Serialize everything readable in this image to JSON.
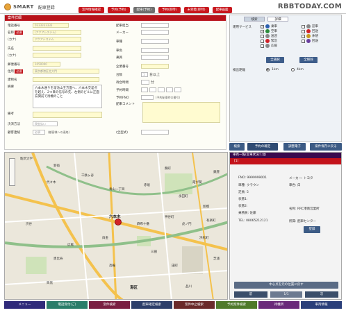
{
  "app": {
    "logo": "SMART",
    "subtitle": "配車登録"
  },
  "watermark": "RBBTODAY.COM",
  "top_tabs": [
    {
      "label": "案件情報確認",
      "color": "#c8181e"
    },
    {
      "label": "予約(予約)",
      "color": "#c8181e"
    },
    {
      "label": "配車(予約)",
      "color": "#6f6f6f"
    },
    {
      "label": "予約(即時)",
      "color": "#c8181e"
    },
    {
      "label": "未到着(即時)",
      "color": "#c8181e"
    },
    {
      "label": "配車画面",
      "color": "#c8181e"
    }
  ],
  "form": {
    "header": "案件詳細",
    "fields": {
      "phone": {
        "label": "電話番号",
        "value": "0333333333"
      },
      "name": {
        "label": "名称",
        "value": "(アクアシステム)",
        "required": "必須"
      },
      "kana": {
        "label": "(カナ)",
        "value": "アクアシステム"
      },
      "person": {
        "label": "氏名",
        "value": ""
      },
      "person_kana": {
        "label": "(カナ)",
        "value": ""
      },
      "postal": {
        "label": "郵便番号",
        "value": "1050000"
      },
      "address": {
        "label": "住所",
        "value": "東京都港区芝大門",
        "required": "必須"
      },
      "building": {
        "label": "建物名",
        "value": ""
      },
      "memo": {
        "label": "摘要",
        "value": "六本木通りを溜池山王方面へ、六本木交差点を越え、2つ目の信号の先、左側のビルに正面玄関前で待機のこと"
      },
      "note": {
        "label": "備考",
        "value": ""
      },
      "payment": {
        "label": "決済方法",
        "value": "現金払い"
      },
      "contact": {
        "label": "顧客連絡",
        "value": "必須",
        "hint": "(顧客様への連絡)"
      }
    },
    "right_fields": {
      "dispatch": "配車担当",
      "maker": "メーカー",
      "car_type": "車種",
      "car_color": "車色",
      "passengers": "乗員",
      "company": "企業番号",
      "count": "台数",
      "count_value": "1",
      "count_unit": "台以上",
      "wait": "待合時間",
      "wait_unit": "分",
      "reserve_time": "予約時間",
      "reserve_fno": "予約FNO",
      "reserve_fno_hint": "(予約配車時の番号)",
      "comment": "配車コメント",
      "extra": "(全型式)"
    }
  },
  "options": {
    "tabs": [
      "検索",
      "詳細"
    ],
    "service_label": "運用サービス",
    "services": [
      {
        "label": "乗車",
        "icon_color": "#2b5fb0",
        "checked": "✓"
      },
      {
        "label": "迎車",
        "icon_color": "#888888",
        "checked": ""
      },
      {
        "label": "空車",
        "icon_color": "#2b8d3a",
        "checked": "✓"
      },
      {
        "label": "回送",
        "icon_color": "#d12228",
        "checked": ""
      },
      {
        "label": "送迎",
        "icon_color": "#888888",
        "checked": ""
      },
      {
        "label": "休憩",
        "icon_color": "#c89a20",
        "checked": ""
      },
      {
        "label": "緊急",
        "icon_color": "#d12228",
        "checked": ""
      },
      {
        "label": "回送",
        "icon_color": "#6a3fa0",
        "checked": ""
      },
      {
        "label": "応援",
        "icon_color": "#888888",
        "checked": ""
      }
    ],
    "select_all": "全選択",
    "deselect_all": "全解除",
    "range_label": "検出距離",
    "ranges": [
      "1km",
      "4km"
    ]
  },
  "actions": [
    "検索",
    "予約の確定",
    "調整電子",
    "案件保存に戻る"
  ],
  "map": {
    "labels": [
      "駒沢大学",
      "新宿",
      "代々木",
      "千駄ヶ谷",
      "青山一丁目",
      "赤坂",
      "六本木",
      "麻布十番",
      "白金",
      "広尾",
      "恵比寿",
      "渋谷",
      "品川",
      "港区",
      "麹町",
      "永田町",
      "神谷町",
      "新橋",
      "浜松町",
      "芝浦",
      "田町",
      "目黒",
      "高輪",
      "三田",
      "虎ノ門",
      "霞が関",
      "銀座",
      "有楽町"
    ]
  },
  "detail": {
    "header": "車両一覧(空車状況:1台)",
    "selected": "[1]",
    "fno_label": "FNO:",
    "fno": "9999999001",
    "maker_label": "メーカー:",
    "maker": "トヨタ",
    "type_label": "車種:",
    "type": "クラウン",
    "color_label": "車色:",
    "color": "白",
    "seats_label": "定員:",
    "seats": "5",
    "status_label": "状態1:",
    "status2_label": "状態2:",
    "driver_label": "乗務員:",
    "driver": "佐藤",
    "office_label": "名称:",
    "office": "RRC港南営業所",
    "tel_label": "TEL:",
    "tel": "08065212121",
    "tel2_label": "所属:",
    "tel2": "配車センター",
    "btn": "登録",
    "footer_btn": "中心点を元の位置に戻す",
    "pager_prev": "前",
    "pager_mid": "1/1",
    "pager_next": "次"
  },
  "footer": [
    {
      "label": "メニュー",
      "color": "#2f2a7a"
    },
    {
      "label": "電話受付(ご)",
      "color": "#2b7d6a"
    },
    {
      "label": "案件検索",
      "color": "#7a1f42"
    },
    {
      "label": "配車確定検索",
      "color": "#2d3f6a"
    },
    {
      "label": "案件中止検索",
      "color": "#6a2a2a"
    },
    {
      "label": "予約案件検索",
      "color": "#4f7a2a"
    },
    {
      "label": "待機所",
      "color": "#6a2a7a"
    },
    {
      "label": "車両情報",
      "color": "#2a3f7a"
    }
  ]
}
